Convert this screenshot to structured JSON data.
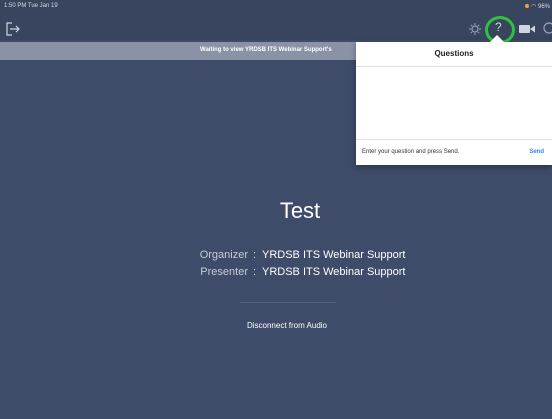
{
  "status_bar": {
    "time": "1:50 PM  Tue Jan 19",
    "battery": "96%"
  },
  "toolbar": {
    "icons": [
      "leave-icon",
      "settings-icon",
      "question-icon",
      "video-icon",
      "cut-icon"
    ],
    "highlight_color": "#2cc33e"
  },
  "banner": {
    "text": "Waiting to view YRDSB ITS Webinar Support's"
  },
  "meeting": {
    "title": "Test",
    "organizer_label": "Organizer",
    "organizer_value": "YRDSB ITS Webinar Support",
    "presenter_label": "Presenter",
    "presenter_value": "YRDSB ITS Webinar Support",
    "separator": ":",
    "disconnect_label": "Disconnect from Audio"
  },
  "questions_panel": {
    "title": "Questions",
    "input_placeholder": "Enter your question and press Send.",
    "send_label": "Send"
  },
  "colors": {
    "background": "#3e4b69",
    "banner": "#8a93a6",
    "send": "#2f8be6"
  }
}
